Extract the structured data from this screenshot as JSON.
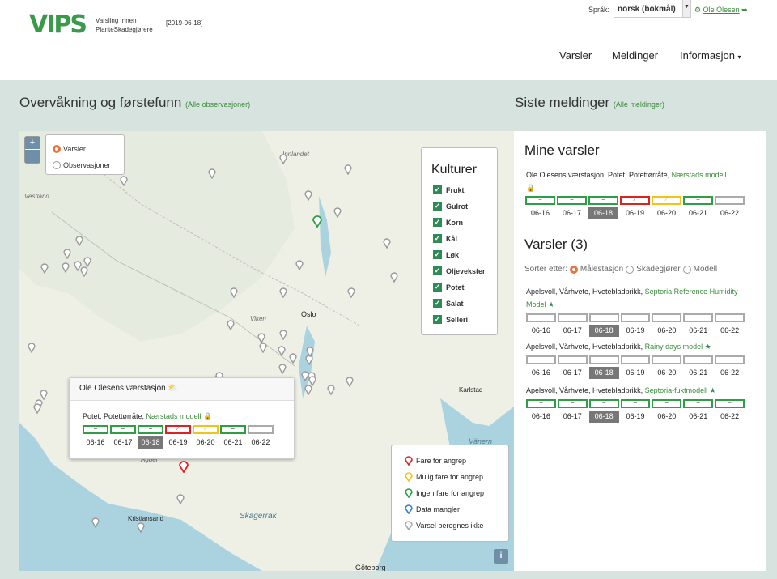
{
  "header": {
    "logo_text": "VIPS",
    "app_name_line1": "Varsling Innen",
    "app_name_line2": "PlanteSkadegjørere",
    "date": "[2019-06-18]",
    "language_label": "Språk:",
    "language_value": "norsk (bokmål)",
    "user": "Ole Olesen",
    "nav": [
      "Varsler",
      "Meldinger",
      "Informasjon"
    ]
  },
  "colors": {
    "accent": "#3a8a3a",
    "green": "#2e9e47",
    "red": "#dd2222",
    "yellow": "#f0c419",
    "grey": "#aaaaaa",
    "today": "#777777"
  },
  "left_section": {
    "title": "Overvåkning og førstefunn",
    "link": "(Alle observasjoner)"
  },
  "right_section": {
    "title": "Siste meldinger",
    "link": "(Alle meldinger)"
  },
  "map": {
    "zoom_in": "+",
    "zoom_out": "−",
    "layers": [
      "Varsler",
      "Observasjoner"
    ],
    "labels": {
      "vestland": "Vestland",
      "innlandet": "Innlandet",
      "viken": "Viken",
      "oslo": "Oslo",
      "agder": "Agder",
      "kristiansand": "Kristiansand",
      "skagerrak": "Skagerrak",
      "vanern": "Vänern",
      "karlstad": "Karlstad",
      "goteborg": "Göteborg"
    },
    "cultures_title": "Kulturer",
    "cultures": [
      "Frukt",
      "Gulrot",
      "Korn",
      "Kål",
      "Løk",
      "Oljevekster",
      "Potet",
      "Salat",
      "Selleri"
    ],
    "legend": [
      "Fare for angrep",
      "Mulig fare for angrep",
      "Ingen fare for angrep",
      "Data mangler",
      "Varsel beregnes ikke"
    ],
    "info": "i",
    "popup": {
      "title": "Ole Olesens værstasjon",
      "line": "Potet, Potettørråte, ",
      "model": "Nærstads modell",
      "statuses": [
        "green",
        "green",
        "green",
        "red",
        "yellow",
        "green",
        "grey"
      ],
      "dates": [
        "06-16",
        "06-17",
        "06-18",
        "06-19",
        "06-20",
        "06-21",
        "06-22"
      ],
      "today_index": 2
    }
  },
  "panel": {
    "mine_title": "Mine varsler",
    "mine_line": "Ole Olesens værstasjon, Potet, Potettørråte, ",
    "mine_model": "Nærstads modell",
    "mine_statuses": [
      "green",
      "green",
      "green",
      "red",
      "yellow",
      "green",
      "grey"
    ],
    "dates": [
      "06-16",
      "06-17",
      "06-18",
      "06-19",
      "06-20",
      "06-21",
      "06-22"
    ],
    "varsler_title": "Varsler (3)",
    "sort_label": "Sorter etter:",
    "sort_options": [
      "Målestasjon",
      "Skadegjører",
      "Modell"
    ],
    "items": [
      {
        "line": "Apelsvoll, Vårhvete, Hvetebladprikk, ",
        "model": "Septoria Reference Humidity Model",
        "statuses": [
          "grey",
          "grey",
          "grey",
          "grey",
          "grey",
          "grey",
          "grey"
        ]
      },
      {
        "line": "Apelsvoll, Vårhvete, Hvetebladprikk, ",
        "model": "Rainy days model",
        "statuses": [
          "grey",
          "grey",
          "grey",
          "grey",
          "grey",
          "grey",
          "grey"
        ]
      },
      {
        "line": "Apelsvoll, Vårhvete, Hvetebladprikk, ",
        "model": "Septoria-fuktmodell",
        "statuses": [
          "green",
          "green",
          "green",
          "green",
          "green",
          "green",
          "green"
        ]
      }
    ]
  }
}
